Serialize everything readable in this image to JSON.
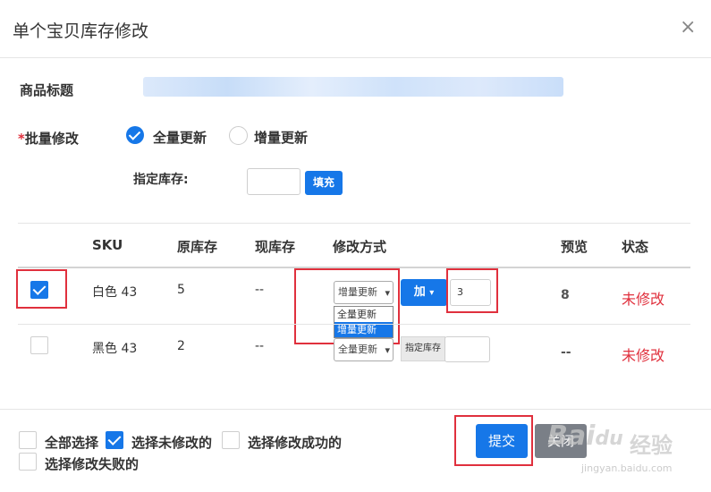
{
  "dialog": {
    "title": "单个宝贝库存修改",
    "close_glyph": "×"
  },
  "form": {
    "product_title_label": "商品标题",
    "batch_required_mark": "*",
    "batch_label": "批量修改",
    "option_full": "全量更新",
    "option_increment": "增量更新",
    "specified_stock_label": "指定库存:",
    "fill_button": "填充"
  },
  "table": {
    "headers": [
      "SKU",
      "原库存",
      "现库存",
      "修改方式",
      "预览",
      "状态"
    ],
    "rows": [
      {
        "sku": "白色 43",
        "original": "5",
        "current": "--",
        "mode_selected": "增量更新",
        "op_button": "加",
        "op_caret": "▾",
        "value": "3",
        "preview": "8",
        "status": "未修改",
        "dropdown_options": [
          "全量更新",
          "增量更新"
        ]
      },
      {
        "sku": "黑色 43",
        "original": "2",
        "current": "--",
        "mode_selected": "全量更新",
        "op_button": "指定库存",
        "value": "",
        "preview": "--",
        "status": "未修改"
      }
    ]
  },
  "footer": {
    "select_all": "全部选择",
    "select_unmodified": "选择未修改的",
    "select_success": "选择修改成功的",
    "select_failed": "选择修改失败的",
    "submit": "提交",
    "cancel": "关闭"
  },
  "watermark": {
    "brand": "Bai",
    "brand_tail": "du",
    "brand_cn": "经验",
    "url": "jingyan.baidu.com"
  },
  "icons": {
    "caret": "▾"
  },
  "colors": {
    "accent": "#1677e8",
    "danger": "#e0303d",
    "annotation": "#e0303d"
  }
}
